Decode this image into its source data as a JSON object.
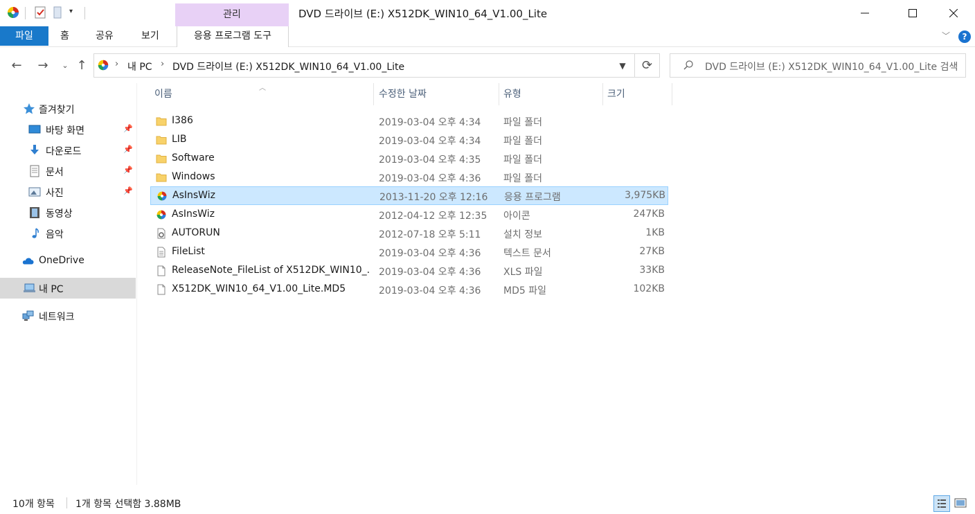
{
  "titlebar": {
    "manage_tab": "관리",
    "title": "DVD 드라이브 (E:) X512DK_WIN10_64_V1.00_Lite",
    "minimize": "—",
    "maximize": "☐",
    "close": "✕"
  },
  "ribbon": {
    "file": "파일",
    "home": "홈",
    "share": "공유",
    "view": "보기",
    "app_tools": "응용 프로그램 도구",
    "help": "?"
  },
  "address": {
    "crumbs": [
      "내 PC",
      "DVD 드라이브 (E:) X512DK_WIN10_64_V1.00_Lite"
    ],
    "search_placeholder": "DVD 드라이브 (E:) X512DK_WIN10_64_V1.00_Lite 검색"
  },
  "sidebar": {
    "quick_access": "즐겨찾기",
    "items": [
      {
        "label": "바탕 화면",
        "icon": "desktop-icon",
        "pinned": true
      },
      {
        "label": "다운로드",
        "icon": "download-icon",
        "pinned": true
      },
      {
        "label": "문서",
        "icon": "document-icon",
        "pinned": true
      },
      {
        "label": "사진",
        "icon": "pictures-icon",
        "pinned": true
      },
      {
        "label": "동영상",
        "icon": "video-icon",
        "pinned": false
      },
      {
        "label": "음악",
        "icon": "music-icon",
        "pinned": false
      }
    ],
    "onedrive": "OneDrive",
    "this_pc": "내 PC",
    "network": "네트워크"
  },
  "columns": {
    "name": "이름",
    "date": "수정한 날짜",
    "type": "유형",
    "size": "크기"
  },
  "files": [
    {
      "name": "I386",
      "date": "2019-03-04 오후 4:34",
      "type": "파일 폴더",
      "size": "",
      "icon": "folder-icon"
    },
    {
      "name": "LIB",
      "date": "2019-03-04 오후 4:34",
      "type": "파일 폴더",
      "size": "",
      "icon": "folder-icon"
    },
    {
      "name": "Software",
      "date": "2019-03-04 오후 4:35",
      "type": "파일 폴더",
      "size": "",
      "icon": "folder-icon"
    },
    {
      "name": "Windows",
      "date": "2019-03-04 오후 4:36",
      "type": "파일 폴더",
      "size": "",
      "icon": "folder-icon"
    },
    {
      "name": "AsInsWiz",
      "date": "2013-11-20 오후 12:16",
      "type": "응용 프로그램",
      "size": "3,975KB",
      "icon": "app-icon",
      "selected": true
    },
    {
      "name": "AsInsWiz",
      "date": "2012-04-12 오후 12:35",
      "type": "아이콘",
      "size": "247KB",
      "icon": "app-icon"
    },
    {
      "name": "AUTORUN",
      "date": "2012-07-18 오후 5:11",
      "type": "설치 정보",
      "size": "1KB",
      "icon": "setup-info-icon"
    },
    {
      "name": "FileList",
      "date": "2019-03-04 오후 4:36",
      "type": "텍스트 문서",
      "size": "27KB",
      "icon": "text-file-icon"
    },
    {
      "name": "ReleaseNote_FileList of X512DK_WIN10_...",
      "date": "2019-03-04 오후 4:36",
      "type": "XLS 파일",
      "size": "33KB",
      "icon": "file-icon"
    },
    {
      "name": "X512DK_WIN10_64_V1.00_Lite.MD5",
      "date": "2019-03-04 오후 4:36",
      "type": "MD5 파일",
      "size": "102KB",
      "icon": "file-icon"
    }
  ],
  "status": {
    "count": "10개 항목",
    "selection": "1개 항목 선택함 3.88MB"
  },
  "colors": {
    "accent": "#1979ca",
    "selection_bg": "#cce8ff",
    "manage_tab_bg": "#e8d1f6"
  }
}
